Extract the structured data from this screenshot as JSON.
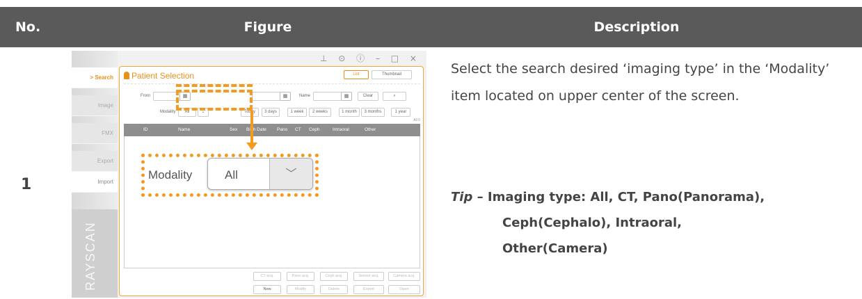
{
  "table": {
    "headers": {
      "no": "No.",
      "figure": "Figure",
      "description": "Description"
    },
    "row_number": "1"
  },
  "figure": {
    "window_controls": "⊥ ⊙ ⓘ – □ ×",
    "sidebar": {
      "items": [
        "> Search",
        "Image",
        "FMX",
        "Export",
        "Import"
      ],
      "brand": "RAYSCAN"
    },
    "panel": {
      "title": "Patient Selection",
      "view_tabs": [
        "List",
        "Thumbnail"
      ],
      "from_label": "From",
      "name_label": "Name",
      "clear_button": "Clear",
      "search_icon": "search-icon",
      "modality_label": "Modality",
      "modality_value": "All",
      "period_buttons": [
        "Today",
        "3 days",
        "1 week",
        "2 weeks",
        "1 month",
        "3 months",
        "1 year"
      ],
      "all_count": "All 0",
      "grid_columns": [
        "ID",
        "Name",
        "Sex",
        "Birth Date",
        "Pano",
        "CT",
        "Ceph",
        "Intraoral",
        "Other"
      ],
      "acq_buttons": [
        "CT acq.",
        "Pano acq.",
        "Ceph acq.",
        "Sensor acq.",
        "Camera acq."
      ],
      "action_buttons": [
        "New",
        "Modify",
        "Delete",
        "Export",
        "Open"
      ]
    },
    "zoom": {
      "label": "Modality",
      "value": "All"
    },
    "highlight_color": "#f39a1f"
  },
  "description": {
    "text": "Select the search desired ‘imaging type’ in the ‘Modality’ item located on upper center of the screen.",
    "tip_word": "Tip",
    "tip_dash": " – ",
    "tip_line1": "Imaging type: All, CT, Pano(Panorama),",
    "tip_line2": "Ceph(Cephalo), Intraoral,",
    "tip_line3": "Other(Camera)"
  }
}
